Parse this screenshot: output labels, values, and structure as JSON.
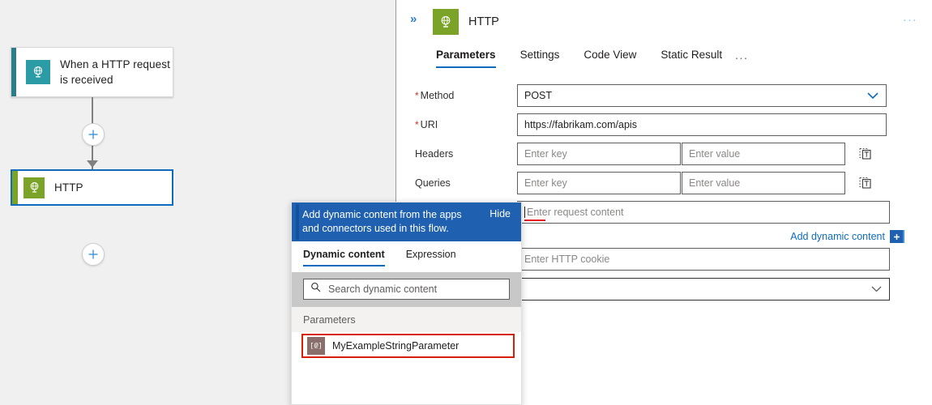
{
  "canvas": {
    "trigger_node": {
      "label": "When a HTTP request is received",
      "icon": "http-request-trigger-icon",
      "accent_color": "#2b7e87"
    },
    "action_node": {
      "label": "HTTP",
      "icon": "http-globe-icon",
      "accent_color": "#7aa328",
      "selected_border_color": "#0f6cbd"
    },
    "add_step_buttons": [
      "plus-icon",
      "plus-icon"
    ],
    "background_color": "#f0f0f0"
  },
  "panel": {
    "collapse_icon": "chevron-double-right-icon",
    "app_icon": "http-globe-icon",
    "title": "HTTP",
    "more_menu": "...",
    "tabs": [
      {
        "label": "Parameters",
        "active": true
      },
      {
        "label": "Settings",
        "active": false
      },
      {
        "label": "Code View",
        "active": false
      },
      {
        "label": "Static Result",
        "active": false
      }
    ],
    "tabs_overflow": "...",
    "accent_color": "#0f6cbd"
  },
  "form": {
    "method": {
      "label": "Method",
      "required": true,
      "value": "POST",
      "chevron": "chevron-down-icon"
    },
    "uri": {
      "label": "URI",
      "required": true,
      "value": "https://fabrikam.com/apis"
    },
    "headers": {
      "label": "Headers",
      "required": false,
      "key_placeholder": "Enter key",
      "value_placeholder": "Enter value",
      "delete_icon": "delete-icon"
    },
    "queries": {
      "label": "Queries",
      "required": false,
      "key_placeholder": "Enter key",
      "value_placeholder": "Enter value",
      "delete_icon": "delete-icon"
    },
    "body": {
      "placeholder": "Enter request content"
    },
    "add_dynamic_content": {
      "label": "Add dynamic content",
      "plus": "+",
      "color": "#0f6cbd"
    },
    "cookie": {
      "placeholder": "Enter HTTP cookie"
    },
    "extra_dropdown": {
      "value": "",
      "chevron": "chevron-down-icon"
    }
  },
  "flyout": {
    "header_text": "Add dynamic content from the apps and connectors used in this flow.",
    "hide_label": "Hide",
    "header_color": "#1f60b0",
    "tabs": [
      {
        "label": "Dynamic content",
        "active": true
      },
      {
        "label": "Expression",
        "active": false
      }
    ],
    "search": {
      "icon": "search-icon",
      "placeholder": "Search dynamic content"
    },
    "group_label": "Parameters",
    "items": [
      {
        "label": "MyExampleStringParameter",
        "icon": "[@]",
        "icon_name": "parameter-token-icon",
        "highlight_color": "#d81e05"
      }
    ]
  }
}
